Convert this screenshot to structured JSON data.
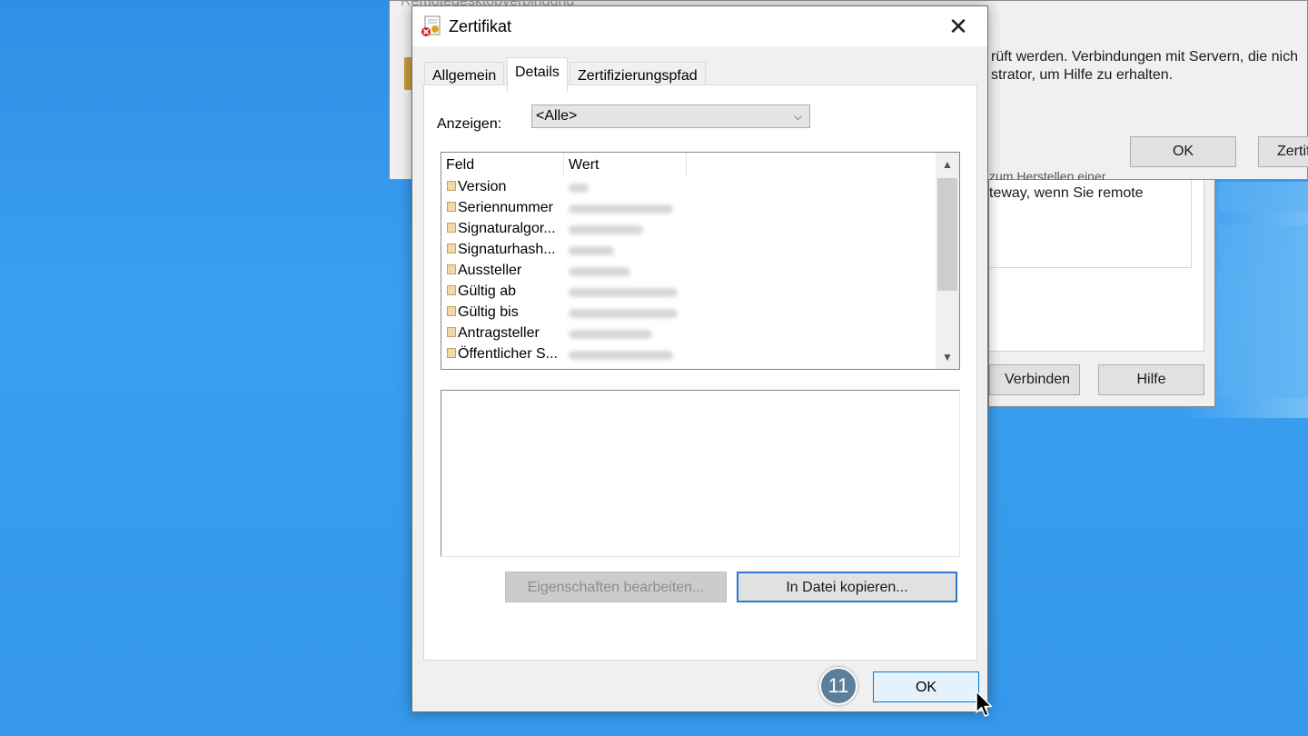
{
  "background_window": {
    "title": "Remotedesktopverbindung",
    "message_line1": "rüft werden. Verbindungen mit Servern, die nich",
    "message_line2": "strator, um Hilfe zu erhalten.",
    "ok_label": "OK",
    "cert_label": "Zertif"
  },
  "background_window2": {
    "cut_text": "zum Herstellen einer",
    "text": "teway, wenn Sie remote",
    "connect_label": "Verbinden",
    "help_label": "Hilfe"
  },
  "dialog": {
    "title": "Zertifikat",
    "close_glyph": "✕",
    "tabs": [
      {
        "label": "Allgemein",
        "active": false
      },
      {
        "label": "Details",
        "active": true
      },
      {
        "label": "Zertifizierungspfad",
        "active": false
      }
    ],
    "show_label": "Anzeigen:",
    "show_value": "<Alle>",
    "columns": {
      "field": "Feld",
      "value": "Wert"
    },
    "rows": [
      {
        "field": "Version"
      },
      {
        "field": "Seriennummer"
      },
      {
        "field": "Signaturalgor..."
      },
      {
        "field": "Signaturhash..."
      },
      {
        "field": "Aussteller"
      },
      {
        "field": "Gültig ab"
      },
      {
        "field": "Gültig bis"
      },
      {
        "field": "Antragsteller"
      },
      {
        "field": "Öffentlicher S..."
      }
    ],
    "edit_properties_label": "Eigenschaften bearbeiten...",
    "copy_to_file_label": "In Datei kopieren...",
    "ok_label": "OK"
  },
  "step_badge": "11",
  "colors": {
    "desktop": "#3a9ff0",
    "accent": "#0078d7",
    "badge": "#5b7f98"
  }
}
